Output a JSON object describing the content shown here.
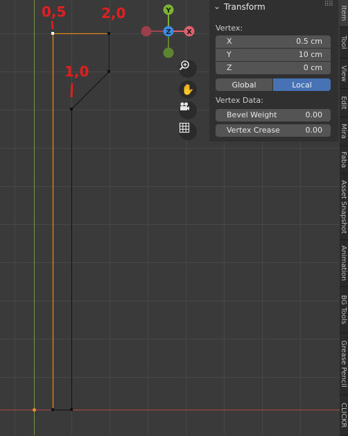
{
  "annotations": {
    "top_left": "0,5",
    "top_right": "2,0",
    "middle": "1,0"
  },
  "gizmo": {
    "y_label": "Y",
    "z_label": "Z",
    "x_label": "X",
    "colors": {
      "x": "#e06070",
      "y": "#7bb332",
      "z": "#3a8de0"
    }
  },
  "nav_buttons": [
    "zoom-icon",
    "hand-pan-icon",
    "camera-icon",
    "grid-ortho-icon"
  ],
  "panel": {
    "title": "Transform",
    "vertex_heading": "Vertex:",
    "fields": [
      {
        "label": "X",
        "value": "0.5 cm"
      },
      {
        "label": "Y",
        "value": "10 cm"
      },
      {
        "label": "Z",
        "value": "0 cm"
      }
    ],
    "space_options": [
      "Global",
      "Local"
    ],
    "space_selected": "Local",
    "vertex_data_heading": "Vertex Data:",
    "bevel": {
      "label": "Bevel Weight",
      "value": "0.00"
    },
    "crease": {
      "label": "Vertex Crease",
      "value": "0.00"
    },
    "accent": "#4772b3"
  },
  "tabs": [
    "Item",
    "Tool",
    "View",
    "Edit",
    "Mira",
    "Faba",
    "Asset Snapshot",
    "Animation",
    "BG Tools",
    "Grease Pencil",
    "CLICKR"
  ]
}
